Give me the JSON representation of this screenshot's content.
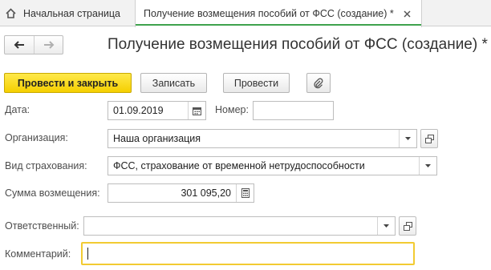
{
  "tabs": [
    {
      "label": "Начальная страница"
    },
    {
      "label": "Получение возмещения пособий от ФСС (создание) *"
    }
  ],
  "page_title": "Получение возмещения пособий от ФСС (создание) *",
  "toolbar": {
    "post_close_label": "Провести и закрыть",
    "save_label": "Записать",
    "post_label": "Провести"
  },
  "form": {
    "date_label": "Дата:",
    "date_value": "01.09.2019",
    "number_label": "Номер:",
    "number_value": "",
    "organization_label": "Организация:",
    "organization_value": "Наша организация",
    "insurance_type_label": "Вид страхования:",
    "insurance_type_value": "ФСС, страхование от временной нетрудоспособности",
    "amount_label": "Сумма возмещения:",
    "amount_value": "301 095,20",
    "responsible_label": "Ответственный:",
    "responsible_value": "",
    "comment_label": "Комментарий:",
    "comment_value": ""
  },
  "colors": {
    "primary_button": "#f5cf00",
    "active_tab_accent": "#3fa34d",
    "focus_border": "#f2cb32"
  }
}
